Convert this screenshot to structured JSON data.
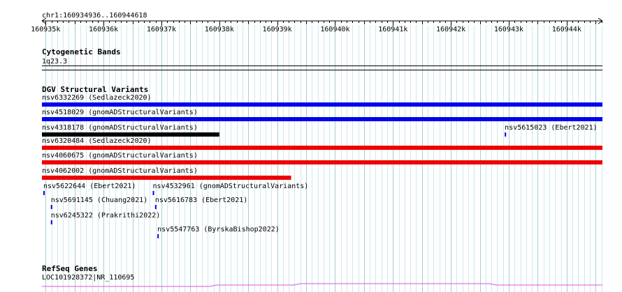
{
  "region": "chr1:160934936..160944618",
  "ruler": {
    "start": 160934936,
    "end": 160944618,
    "tick_labels": [
      "160935k",
      "160936k",
      "160937k",
      "160938k",
      "160939k",
      "160940k",
      "160941k",
      "160942k",
      "160943k",
      "160944k"
    ],
    "major_ticks": [
      160935000,
      160936000,
      160937000,
      160938000,
      160939000,
      160940000,
      160941000,
      160942000,
      160943000,
      160944000
    ]
  },
  "colors": {
    "grid_major": "#9fd0d8",
    "grid_minor": "#cde9ee",
    "loss": "#0000ee",
    "gain": "#ee0000",
    "complex": "#000000",
    "gene": "#dd55dd"
  },
  "tracks": {
    "cytoband": {
      "title": "Cytogenetic Bands",
      "label": "1q23.3"
    },
    "dgv": {
      "title": "DGV Structural Variants",
      "features": [
        {
          "label": "nsv6332269 (Sedlazeck2020)",
          "start": 160934936,
          "end": 160944618,
          "type": "loss",
          "row": 0
        },
        {
          "label": "nsv4518029 (gnomADStructuralVariants)",
          "start": 160934936,
          "end": 160944618,
          "type": "loss",
          "row": 1
        },
        {
          "label": "nsv4318178 (gnomADStructuralVariants)",
          "start": 160934936,
          "end": 160938000,
          "type": "complex",
          "row": 2
        },
        {
          "label": "nsv5615023 (Ebert2021)",
          "start": 160942930,
          "end": 160942950,
          "type": "loss",
          "row": 2
        },
        {
          "label": "nsv6320484 (Sedlazeck2020)",
          "start": 160934936,
          "end": 160944618,
          "type": "gain",
          "row": 3
        },
        {
          "label": "nsv4060675 (gnomADStructuralVariants)",
          "start": 160934936,
          "end": 160944618,
          "type": "gain",
          "row": 4
        },
        {
          "label": "nsv4062002 (gnomADStructuralVariants)",
          "start": 160934936,
          "end": 160939240,
          "type": "gain",
          "row": 5
        },
        {
          "label": "nsv5622644 (Ebert2021)",
          "start": 160934960,
          "end": 160934985,
          "type": "loss",
          "row": 6
        },
        {
          "label": "nsv4532961 (gnomADStructuralVariants)",
          "start": 160936850,
          "end": 160936875,
          "type": "loss",
          "row": 6
        },
        {
          "label": "nsv5691145 (Chuang2021)",
          "start": 160935090,
          "end": 160935115,
          "type": "loss",
          "row": 7
        },
        {
          "label": "nsv5616783 (Ebert2021)",
          "start": 160936890,
          "end": 160936915,
          "type": "loss",
          "row": 7
        },
        {
          "label": "nsv6245322 (Prakrithi2022)",
          "start": 160935090,
          "end": 160935115,
          "type": "loss",
          "row": 8
        },
        {
          "label": "nsv5547763 (ByrskaBishop2022)",
          "start": 160936930,
          "end": 160936955,
          "type": "loss",
          "row": 9
        }
      ]
    },
    "refseq": {
      "title": "RefSeq Genes",
      "label": "LOC101928372|NR_110695"
    }
  }
}
